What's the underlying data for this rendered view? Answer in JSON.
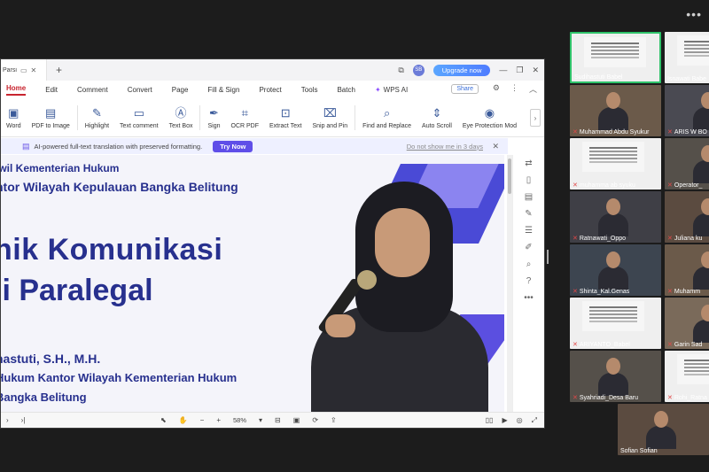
{
  "stage": {
    "dots": "•••"
  },
  "wps": {
    "tab_label": "Parsi",
    "upgrade_label": "Upgrade now",
    "avatar_initials": "SB",
    "menu": [
      "Home",
      "Edit",
      "Comment",
      "Convert",
      "Page",
      "Fill & Sign",
      "Protect",
      "Tools",
      "Batch"
    ],
    "wps_ai_label": "WPS AI",
    "share_label": "Share",
    "tools": [
      "Word",
      "PDF to Image",
      "Highlight",
      "Text comment",
      "Text Box",
      "Sign",
      "OCR PDF",
      "Extract Text",
      "Snip and Pin",
      "Find and Replace",
      "Auto Scroll",
      "Eye Protection Mod"
    ],
    "ai_banner": {
      "message": "AI-powered full-text translation with preserved formatting.",
      "try_now": "Try Now",
      "dont_show": "Do not show me in 3 days"
    },
    "doc": {
      "line1": "iwil Kementerian Hukum",
      "line2": "ntor Wilayah Kepulauan Bangka Belitung",
      "big1": "nik Komunikasi",
      "big2": "ji Paralegal",
      "name": "hastuti, S.H., M.H.",
      "role": "Hukum Kantor Wilayah Kementerian Hukum",
      "place": "Bangka Belitung"
    },
    "status": {
      "zoom": "58%"
    }
  },
  "gallery": [
    {
      "name": "Sudihastuti Babel",
      "kind": "slide",
      "active": true,
      "muted": false
    },
    {
      "name": "Isnawati Babe",
      "kind": "slide",
      "active": false,
      "muted": false
    },
    {
      "name": "Muhammad Abdu Syukur",
      "kind": "person",
      "active": false,
      "muted": true
    },
    {
      "name": "ARIS W BO",
      "kind": "person",
      "active": false,
      "muted": true
    },
    {
      "name": "muhamma ab syuku",
      "kind": "slide",
      "active": false,
      "muted": true
    },
    {
      "name": "Operator_",
      "kind": "person",
      "active": false,
      "muted": true
    },
    {
      "name": "Ratnawati_Oppo",
      "kind": "person",
      "active": false,
      "muted": true
    },
    {
      "name": "Juliana ku",
      "kind": "person",
      "active": false,
      "muted": true
    },
    {
      "name": "Shinta_Kal.Genas",
      "kind": "person",
      "active": false,
      "muted": true
    },
    {
      "name": "Muhamm",
      "kind": "person",
      "active": false,
      "muted": true
    },
    {
      "name": "ARIYANTO_Babel",
      "kind": "slide",
      "active": false,
      "muted": true
    },
    {
      "name": "Garin Sad",
      "kind": "person",
      "active": false,
      "muted": true
    },
    {
      "name": "Syahriadi_Desa Baru",
      "kind": "person",
      "active": false,
      "muted": true
    },
    {
      "name": "Rohi_Ratna",
      "kind": "slide",
      "active": false,
      "muted": true
    },
    {
      "name": "Sofian Sofian",
      "kind": "person",
      "active": false,
      "muted": false
    }
  ]
}
